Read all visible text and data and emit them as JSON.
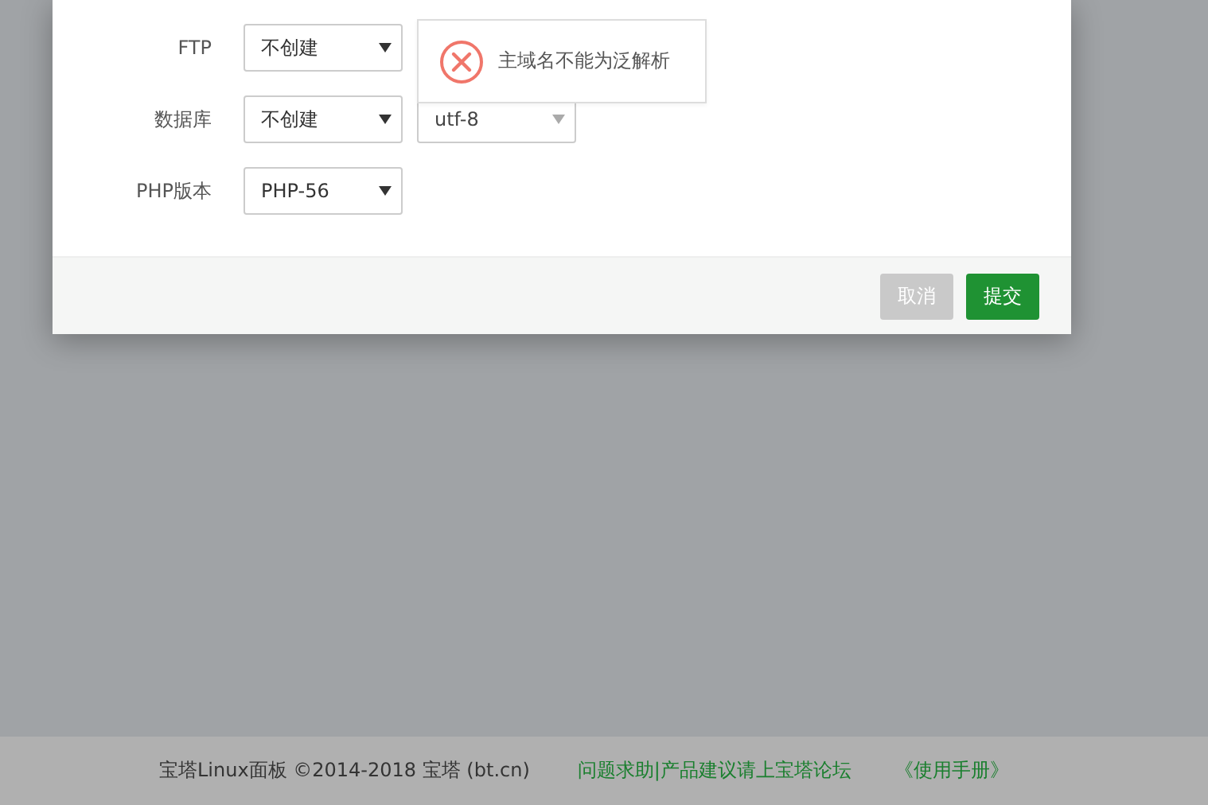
{
  "form": {
    "rows": [
      {
        "label": "FTP",
        "selects": [
          "不创建"
        ]
      },
      {
        "label": "数据库",
        "selects": [
          "不创建",
          "utf-8"
        ]
      },
      {
        "label": "PHP版本",
        "selects": [
          "PHP-56"
        ]
      }
    ]
  },
  "toast": {
    "kind": "error",
    "message": "主域名不能为泛解析"
  },
  "buttons": [
    {
      "label": "取消",
      "kind": "cancel"
    },
    {
      "label": "提交",
      "kind": "submit"
    }
  ],
  "footer": {
    "copyright": "宝塔Linux面板 ©2014-2018 宝塔 (bt.cn)",
    "links": [
      "问题求助|产品建议请上宝塔论坛",
      "《使用手册》"
    ]
  }
}
